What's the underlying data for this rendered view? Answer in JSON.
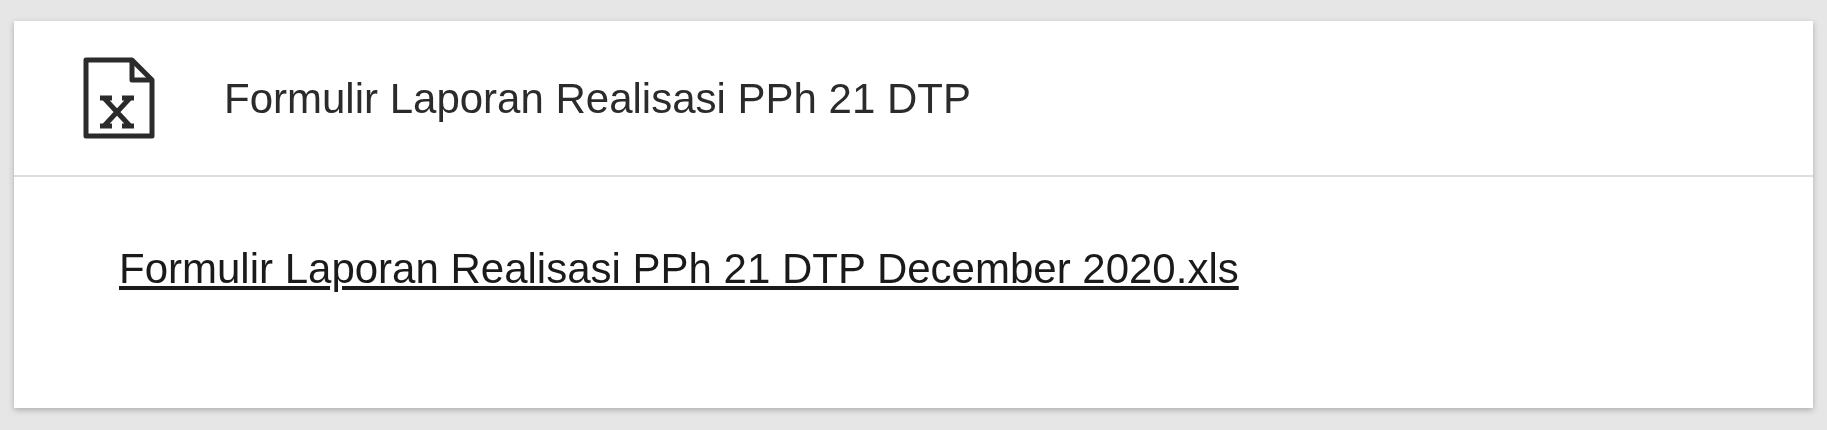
{
  "card": {
    "title": "Formulir Laporan Realisasi PPh 21 DTP",
    "files": [
      {
        "label": "Formulir Laporan Realisasi PPh 21 DTP December 2020.xls"
      }
    ]
  }
}
